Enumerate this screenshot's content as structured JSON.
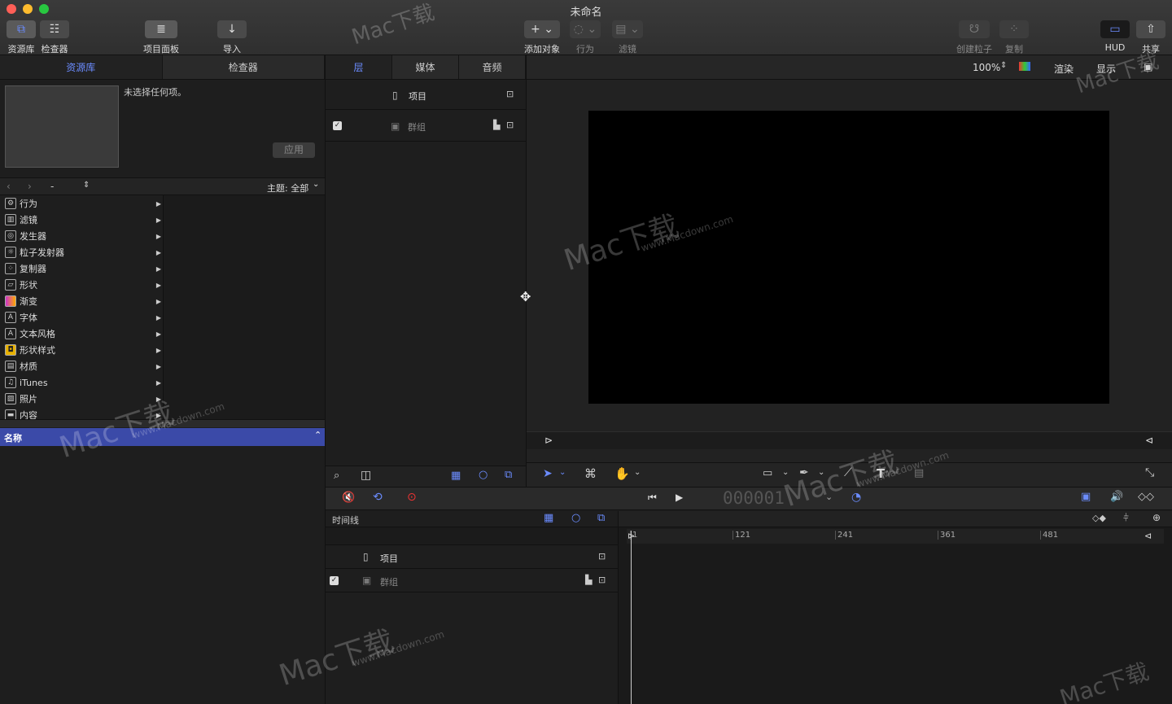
{
  "window": {
    "title": "未命名"
  },
  "toolbar": {
    "library": "资源库",
    "inspector": "检查器",
    "project_panel": "项目面板",
    "import": "导入",
    "add_object": "添加对象",
    "behavior": "行为",
    "filter": "滤镜",
    "create_particles": "创建粒子",
    "replicate": "复制",
    "hud": "HUD",
    "share": "共享"
  },
  "left": {
    "tabs": [
      "资源库",
      "检查器"
    ],
    "no_selection": "未选择任何项。",
    "apply": "应用",
    "nav_dash": "-",
    "theme": "主题: 全部",
    "categories": [
      {
        "label": "行为",
        "icon": "gear-icon"
      },
      {
        "label": "滤镜",
        "icon": "filter-icon"
      },
      {
        "label": "发生器",
        "icon": "generator-icon"
      },
      {
        "label": "粒子发射器",
        "icon": "particle-icon"
      },
      {
        "label": "复制器",
        "icon": "replicator-icon"
      },
      {
        "label": "形状",
        "icon": "shape-icon"
      },
      {
        "label": "渐变",
        "icon": "gradient-icon"
      },
      {
        "label": "字体",
        "icon": "font-icon"
      },
      {
        "label": "文本风格",
        "icon": "text-style-icon"
      },
      {
        "label": "形状样式",
        "icon": "shape-style-icon"
      },
      {
        "label": "材质",
        "icon": "material-icon"
      },
      {
        "label": "iTunes",
        "icon": "itunes-icon"
      },
      {
        "label": "照片",
        "icon": "photo-icon"
      },
      {
        "label": "内容",
        "icon": "folder-icon"
      }
    ],
    "name_header": "名称"
  },
  "middle": {
    "tabs": [
      "层",
      "媒体",
      "音频"
    ],
    "project": "项目",
    "group": "群组"
  },
  "canvas": {
    "zoom": "100%",
    "render": "渲染",
    "view": "显示"
  },
  "transport": {
    "timecode": "000001"
  },
  "timeline": {
    "label": "时间线",
    "project": "项目",
    "group": "群组",
    "ticks": [
      "1",
      "121",
      "241",
      "361",
      "481"
    ]
  },
  "watermark": {
    "brand": "Mac下载",
    "url": "www.Macdown.com"
  },
  "colors": {
    "accent": "#6b8cff",
    "selection": "#3b4aa8"
  }
}
